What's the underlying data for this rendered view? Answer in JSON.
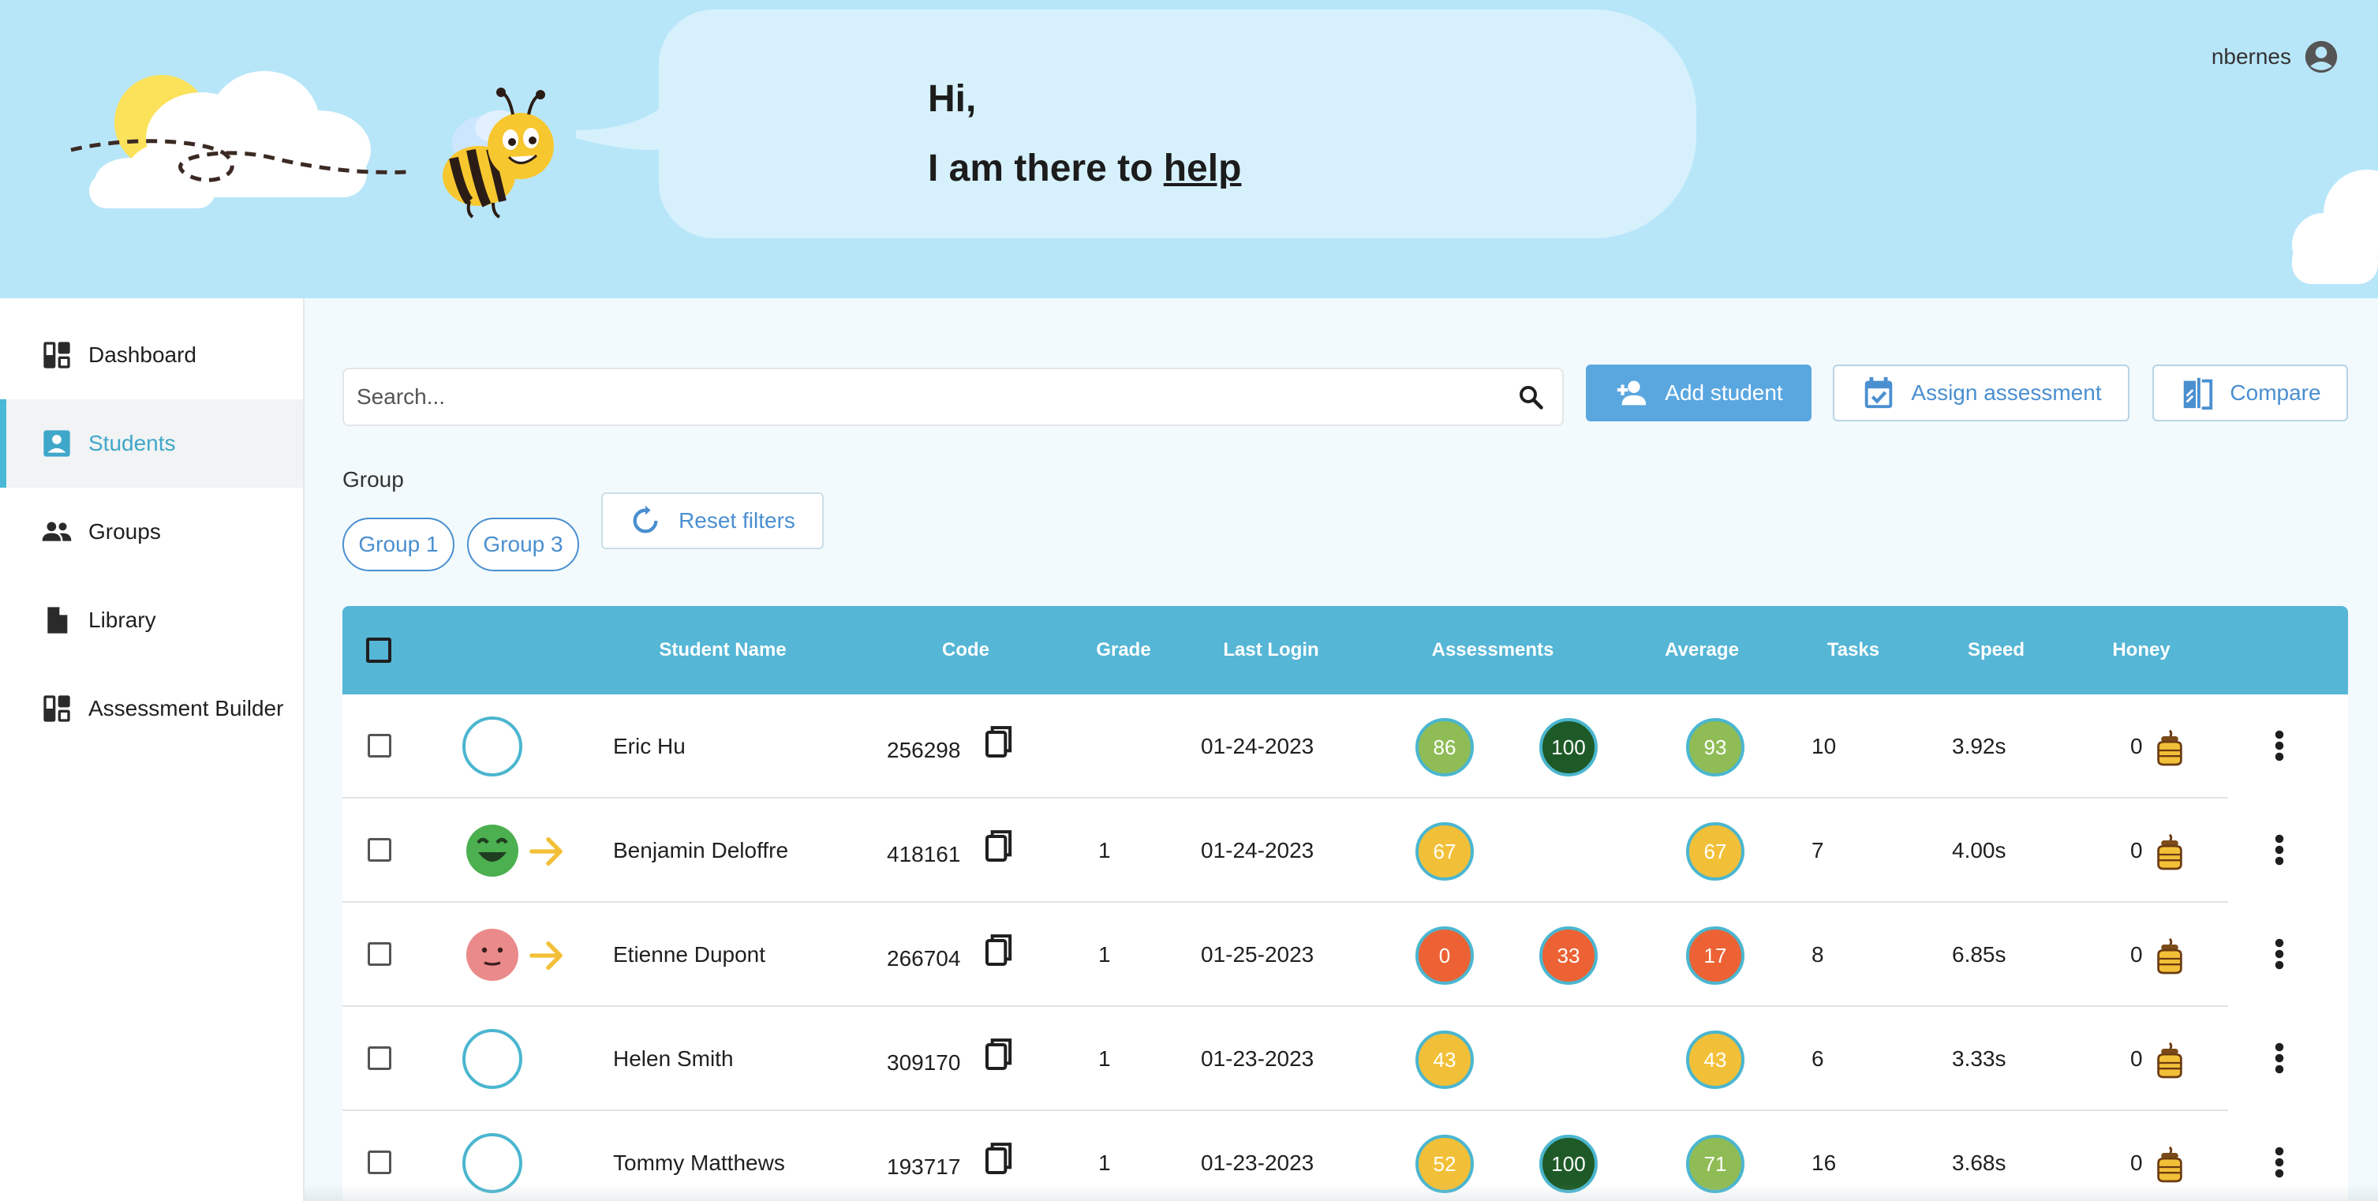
{
  "header": {
    "greeting_line1": "Hi,",
    "greeting_line2_prefix": "I am there to ",
    "greeting_line2_link": "help",
    "username": "nbernes"
  },
  "sidebar": {
    "items": [
      {
        "label": "Dashboard",
        "icon": "dashboard-icon",
        "active": false
      },
      {
        "label": "Students",
        "icon": "student-icon",
        "active": true
      },
      {
        "label": "Groups",
        "icon": "groups-icon",
        "active": false
      },
      {
        "label": "Library",
        "icon": "document-icon",
        "active": false
      },
      {
        "label": "Assessment Builder",
        "icon": "builder-icon",
        "active": false
      }
    ]
  },
  "toolbar": {
    "search_placeholder": "Search...",
    "add_student_label": "Add student",
    "assign_assessment_label": "Assign assessment",
    "compare_label": "Compare"
  },
  "filters": {
    "group_label": "Group",
    "chips": [
      "Group 1",
      "Group 3"
    ],
    "reset_label": "Reset filters"
  },
  "table": {
    "headers": {
      "name": "Student Name",
      "code": "Code",
      "grade": "Grade",
      "last_login": "Last Login",
      "assessments": "Assessments",
      "average": "Average",
      "tasks": "Tasks",
      "speed": "Speed",
      "honey": "Honey"
    },
    "rows": [
      {
        "name": "Eric Hu",
        "code": "256298",
        "grade": "",
        "last_login": "01-24-2023",
        "mood": "none",
        "assessment1": "86",
        "assessment2": "100",
        "average": "93",
        "tasks": "10",
        "speed": "3.92s",
        "honey": "0"
      },
      {
        "name": "Benjamin Deloffre",
        "code": "418161",
        "grade": "1",
        "last_login": "01-24-2023",
        "mood": "happy",
        "assessment1": "67",
        "assessment2": "",
        "average": "67",
        "tasks": "7",
        "speed": "4.00s",
        "honey": "0"
      },
      {
        "name": "Etienne Dupont",
        "code": "266704",
        "grade": "1",
        "last_login": "01-25-2023",
        "mood": "neutral",
        "assessment1": "0",
        "assessment2": "33",
        "average": "17",
        "tasks": "8",
        "speed": "6.85s",
        "honey": "0"
      },
      {
        "name": "Helen Smith",
        "code": "309170",
        "grade": "1",
        "last_login": "01-23-2023",
        "mood": "none",
        "assessment1": "43",
        "assessment2": "",
        "average": "43",
        "tasks": "6",
        "speed": "3.33s",
        "honey": "0"
      },
      {
        "name": "Tommy Matthews",
        "code": "193717",
        "grade": "1",
        "last_login": "01-23-2023",
        "mood": "none",
        "assessment1": "52",
        "assessment2": "100",
        "average": "71",
        "tasks": "16",
        "speed": "3.68s",
        "honey": "0"
      }
    ]
  },
  "colors": {
    "header_bg": "#b8e6f9",
    "table_header_bg": "#55b6d6",
    "primary_button": "#5aa7e0",
    "score_green_light": "#8fbc55",
    "score_green_dark": "#1e5a28",
    "score_yellow": "#f2c038",
    "score_orange": "#ec6234",
    "accent_blue": "#4a8fd0"
  }
}
